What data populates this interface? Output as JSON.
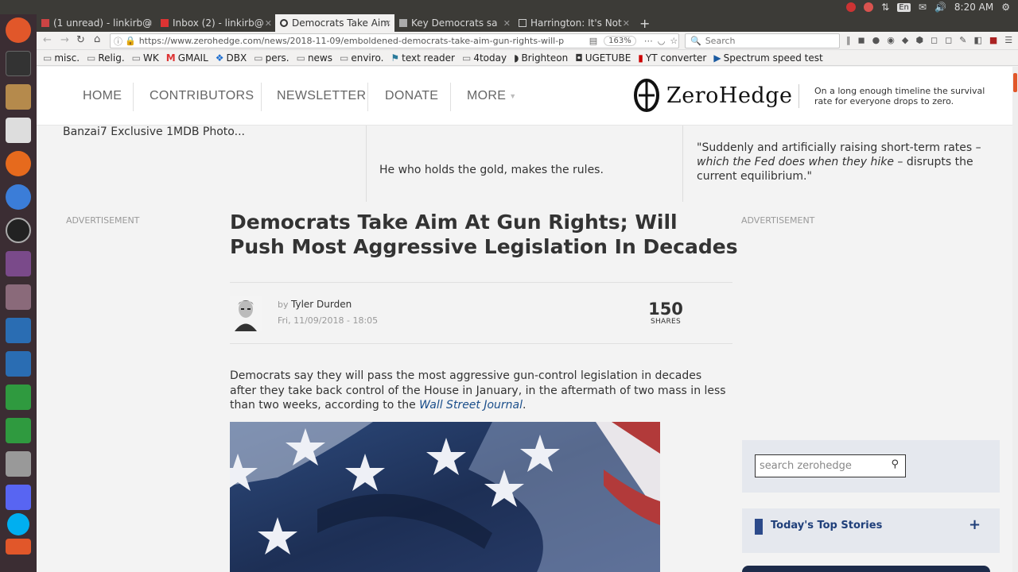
{
  "os": {
    "time": "8:20 AM",
    "kbd": "En"
  },
  "tabs": [
    {
      "label": "(1 unread) - linkirb@"
    },
    {
      "label": "Inbox (2) - linkirb@"
    },
    {
      "label": "Democrats Take Aim"
    },
    {
      "label": "Key Democrats sa"
    },
    {
      "label": "Harrington: It's Not"
    }
  ],
  "browser": {
    "url": "https://www.zerohedge.com/news/2018-11-09/emboldened-democrats-take-aim-gun-rights-will-p",
    "zoom": "163%",
    "search_placeholder": "Search"
  },
  "bookmarks": [
    "misc.",
    "Relig.",
    "WK",
    "GMAIL",
    "DBX",
    "pers.",
    "news",
    "enviro.",
    "text reader",
    "4today",
    "Brighteon",
    "UGETUBE",
    "YT converter",
    "Spectrum speed test"
  ],
  "site": {
    "nav": [
      "HOME",
      "CONTRIBUTORS",
      "NEWSLETTER",
      "DONATE",
      "MORE"
    ],
    "logo": "ZeroHedge",
    "tagline": "On a long enough timeline the survival rate for everyone drops to zero."
  },
  "ticker": {
    "left": "Banzai7 Exclusive 1MDB Photo...",
    "mid": "He who holds the gold, makes the rules.",
    "right_a": "\"Suddenly and artificially raising short-term rates",
    "right_b": "– which the Fed does when they hike",
    "right_c": "– disrupts the current equilibrium.\""
  },
  "ads": {
    "left": "ADVERTISEMENT",
    "right": "ADVERTISEMENT"
  },
  "article": {
    "title": "Democrats Take Aim At Gun Rights; Will Push Most Aggressive Legislation In Decades",
    "by": "by",
    "author": "Tyler Durden",
    "date": "Fri, 11/09/2018 - 18:05",
    "shares": "150",
    "shares_label": "SHARES",
    "body": "Democrats say they will pass the most aggressive gun-control legislation in decades after they take back control of the House in January, in the aftermath of two mass in less than two weeks, according to the ",
    "source": "Wall Street Journal",
    "body_end": "."
  },
  "sidebar": {
    "search_placeholder": "search zerohedge",
    "top_stories": "Today's Top Stories",
    "plus": "+"
  }
}
